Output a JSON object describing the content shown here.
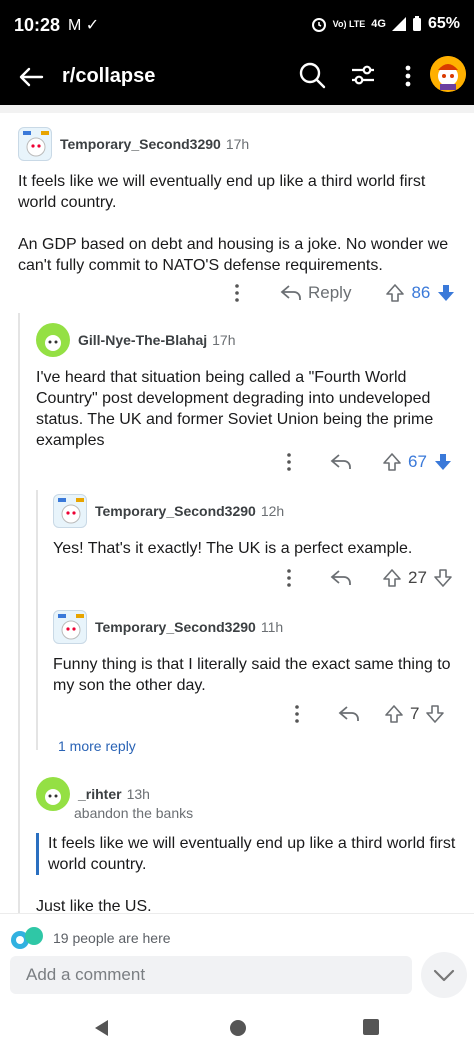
{
  "status_bar": {
    "time": "10:28",
    "left_icons": "M ✓",
    "network": "4G",
    "lte": "Vo) LTE",
    "battery": "65%"
  },
  "app_bar": {
    "title": "r/collapse"
  },
  "comments": [
    {
      "author": "Temporary_Second3290",
      "time": "17h",
      "body": "It feels like we will eventually end up like a third world first world country.\n\nAn GDP based on debt and housing is a joke.  No wonder we can't fully commit to NATO'S defense requirements.",
      "reply_label": "Reply",
      "score": "86"
    },
    {
      "author": "Gill-Nye-The-Blahaj",
      "time": "17h",
      "body": "I've heard that situation being called a \"Fourth World Country\" post development degrading into undeveloped status. The UK and former Soviet Union being the prime examples",
      "score": "67"
    },
    {
      "author": "Temporary_Second3290",
      "time": "12h",
      "body": "Yes!  That's it exactly!  The UK is a perfect example.",
      "score": "27"
    },
    {
      "author": "Temporary_Second3290",
      "time": "11h",
      "body": "Funny thing is that I literally said the exact same thing to my son the other day.",
      "score": "7"
    },
    {
      "author": "_rihter",
      "time": "13h",
      "flair": "abandon the banks",
      "quote": "It feels like we will eventually end up like a third world first world country.",
      "body": "Just like the US."
    }
  ],
  "more_replies": "1 more reply",
  "presence": "19 people are here",
  "composer": {
    "placeholder": "Add a comment"
  },
  "colors": {
    "accent_blue": "#3a79d9",
    "link_blue": "#2a63b5",
    "snoo_green": "#94e044"
  },
  "icons": [
    "back-arrow-icon",
    "search-icon",
    "filter-icon",
    "more-vertical-icon",
    "upvote-icon",
    "downvote-icon",
    "reply-icon",
    "chevron-down-icon",
    "nav-back-icon",
    "nav-home-icon",
    "nav-recents-icon"
  ]
}
